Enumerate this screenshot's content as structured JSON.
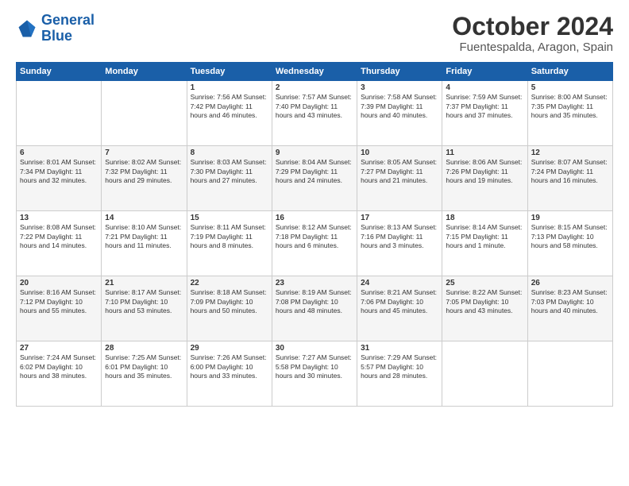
{
  "logo": {
    "line1": "General",
    "line2": "Blue"
  },
  "title": "October 2024",
  "subtitle": "Fuentespalda, Aragon, Spain",
  "weekdays": [
    "Sunday",
    "Monday",
    "Tuesday",
    "Wednesday",
    "Thursday",
    "Friday",
    "Saturday"
  ],
  "weeks": [
    [
      {
        "day": "",
        "info": ""
      },
      {
        "day": "",
        "info": ""
      },
      {
        "day": "1",
        "info": "Sunrise: 7:56 AM\nSunset: 7:42 PM\nDaylight: 11 hours and 46 minutes."
      },
      {
        "day": "2",
        "info": "Sunrise: 7:57 AM\nSunset: 7:40 PM\nDaylight: 11 hours and 43 minutes."
      },
      {
        "day": "3",
        "info": "Sunrise: 7:58 AM\nSunset: 7:39 PM\nDaylight: 11 hours and 40 minutes."
      },
      {
        "day": "4",
        "info": "Sunrise: 7:59 AM\nSunset: 7:37 PM\nDaylight: 11 hours and 37 minutes."
      },
      {
        "day": "5",
        "info": "Sunrise: 8:00 AM\nSunset: 7:35 PM\nDaylight: 11 hours and 35 minutes."
      }
    ],
    [
      {
        "day": "6",
        "info": "Sunrise: 8:01 AM\nSunset: 7:34 PM\nDaylight: 11 hours and 32 minutes."
      },
      {
        "day": "7",
        "info": "Sunrise: 8:02 AM\nSunset: 7:32 PM\nDaylight: 11 hours and 29 minutes."
      },
      {
        "day": "8",
        "info": "Sunrise: 8:03 AM\nSunset: 7:30 PM\nDaylight: 11 hours and 27 minutes."
      },
      {
        "day": "9",
        "info": "Sunrise: 8:04 AM\nSunset: 7:29 PM\nDaylight: 11 hours and 24 minutes."
      },
      {
        "day": "10",
        "info": "Sunrise: 8:05 AM\nSunset: 7:27 PM\nDaylight: 11 hours and 21 minutes."
      },
      {
        "day": "11",
        "info": "Sunrise: 8:06 AM\nSunset: 7:26 PM\nDaylight: 11 hours and 19 minutes."
      },
      {
        "day": "12",
        "info": "Sunrise: 8:07 AM\nSunset: 7:24 PM\nDaylight: 11 hours and 16 minutes."
      }
    ],
    [
      {
        "day": "13",
        "info": "Sunrise: 8:08 AM\nSunset: 7:22 PM\nDaylight: 11 hours and 14 minutes."
      },
      {
        "day": "14",
        "info": "Sunrise: 8:10 AM\nSunset: 7:21 PM\nDaylight: 11 hours and 11 minutes."
      },
      {
        "day": "15",
        "info": "Sunrise: 8:11 AM\nSunset: 7:19 PM\nDaylight: 11 hours and 8 minutes."
      },
      {
        "day": "16",
        "info": "Sunrise: 8:12 AM\nSunset: 7:18 PM\nDaylight: 11 hours and 6 minutes."
      },
      {
        "day": "17",
        "info": "Sunrise: 8:13 AM\nSunset: 7:16 PM\nDaylight: 11 hours and 3 minutes."
      },
      {
        "day": "18",
        "info": "Sunrise: 8:14 AM\nSunset: 7:15 PM\nDaylight: 11 hours and 1 minute."
      },
      {
        "day": "19",
        "info": "Sunrise: 8:15 AM\nSunset: 7:13 PM\nDaylight: 10 hours and 58 minutes."
      }
    ],
    [
      {
        "day": "20",
        "info": "Sunrise: 8:16 AM\nSunset: 7:12 PM\nDaylight: 10 hours and 55 minutes."
      },
      {
        "day": "21",
        "info": "Sunrise: 8:17 AM\nSunset: 7:10 PM\nDaylight: 10 hours and 53 minutes."
      },
      {
        "day": "22",
        "info": "Sunrise: 8:18 AM\nSunset: 7:09 PM\nDaylight: 10 hours and 50 minutes."
      },
      {
        "day": "23",
        "info": "Sunrise: 8:19 AM\nSunset: 7:08 PM\nDaylight: 10 hours and 48 minutes."
      },
      {
        "day": "24",
        "info": "Sunrise: 8:21 AM\nSunset: 7:06 PM\nDaylight: 10 hours and 45 minutes."
      },
      {
        "day": "25",
        "info": "Sunrise: 8:22 AM\nSunset: 7:05 PM\nDaylight: 10 hours and 43 minutes."
      },
      {
        "day": "26",
        "info": "Sunrise: 8:23 AM\nSunset: 7:03 PM\nDaylight: 10 hours and 40 minutes."
      }
    ],
    [
      {
        "day": "27",
        "info": "Sunrise: 7:24 AM\nSunset: 6:02 PM\nDaylight: 10 hours and 38 minutes."
      },
      {
        "day": "28",
        "info": "Sunrise: 7:25 AM\nSunset: 6:01 PM\nDaylight: 10 hours and 35 minutes."
      },
      {
        "day": "29",
        "info": "Sunrise: 7:26 AM\nSunset: 6:00 PM\nDaylight: 10 hours and 33 minutes."
      },
      {
        "day": "30",
        "info": "Sunrise: 7:27 AM\nSunset: 5:58 PM\nDaylight: 10 hours and 30 minutes."
      },
      {
        "day": "31",
        "info": "Sunrise: 7:29 AM\nSunset: 5:57 PM\nDaylight: 10 hours and 28 minutes."
      },
      {
        "day": "",
        "info": ""
      },
      {
        "day": "",
        "info": ""
      }
    ]
  ]
}
